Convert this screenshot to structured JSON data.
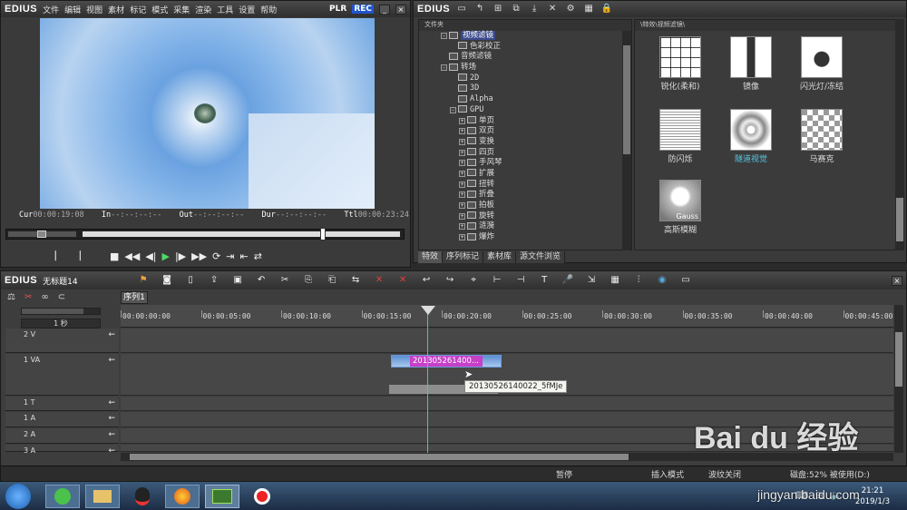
{
  "player": {
    "logo": "EDIUS",
    "menu": [
      "文件",
      "编辑",
      "视图",
      "素材",
      "标记",
      "模式",
      "采集",
      "渲染",
      "工具",
      "设置",
      "帮助"
    ],
    "plr": "PLR",
    "rec": "REC",
    "timecodes": [
      {
        "label": "Cur",
        "value": "00:00:19:08"
      },
      {
        "label": "In",
        "value": "--:--:--:--"
      },
      {
        "label": "Out",
        "value": "--:--:--:--"
      },
      {
        "label": "Dur",
        "value": "--:--:--:--"
      },
      {
        "label": "Ttl",
        "value": "00:00:23:24"
      }
    ]
  },
  "bin": {
    "logo": "EDIUS",
    "folder_header": "文件夹",
    "path_header": "\\特效\\视频滤镜\\",
    "tree": [
      {
        "indent": 2,
        "type": "folder",
        "exp": "-",
        "label": "视频滤镜",
        "selected": true
      },
      {
        "indent": 3,
        "type": "item",
        "exp": "",
        "label": "色彩校正"
      },
      {
        "indent": 2,
        "type": "item",
        "exp": "",
        "label": "音频滤镜"
      },
      {
        "indent": 2,
        "type": "folder",
        "exp": "-",
        "label": "转场"
      },
      {
        "indent": 3,
        "type": "item",
        "exp": "",
        "label": "2D"
      },
      {
        "indent": 3,
        "type": "item",
        "exp": "",
        "label": "3D"
      },
      {
        "indent": 3,
        "type": "item",
        "exp": "",
        "label": "Alpha"
      },
      {
        "indent": 3,
        "type": "folder",
        "exp": "-",
        "label": "GPU"
      },
      {
        "indent": 4,
        "type": "item",
        "exp": "+",
        "label": "单页"
      },
      {
        "indent": 4,
        "type": "item",
        "exp": "+",
        "label": "双页"
      },
      {
        "indent": 4,
        "type": "item",
        "exp": "+",
        "label": "变换"
      },
      {
        "indent": 4,
        "type": "item",
        "exp": "+",
        "label": "四页"
      },
      {
        "indent": 4,
        "type": "item",
        "exp": "+",
        "label": "手风琴"
      },
      {
        "indent": 4,
        "type": "item",
        "exp": "+",
        "label": "扩展"
      },
      {
        "indent": 4,
        "type": "item",
        "exp": "+",
        "label": "扭转"
      },
      {
        "indent": 4,
        "type": "item",
        "exp": "+",
        "label": "折叠"
      },
      {
        "indent": 4,
        "type": "item",
        "exp": "+",
        "label": "拍板"
      },
      {
        "indent": 4,
        "type": "item",
        "exp": "+",
        "label": "旋转"
      },
      {
        "indent": 4,
        "type": "item",
        "exp": "+",
        "label": "涟漪"
      },
      {
        "indent": 4,
        "type": "item",
        "exp": "+",
        "label": "爆炸"
      }
    ],
    "effects": [
      {
        "label": "锐化(柔和)",
        "kind": "grid"
      },
      {
        "label": "镜像",
        "kind": "mirror"
      },
      {
        "label": "闪光灯/冻结",
        "kind": "camera"
      },
      {
        "label": "防闪烁",
        "kind": "lines"
      },
      {
        "label": "隧道视觉",
        "kind": "tunnel",
        "highlight": true
      },
      {
        "label": "马赛克",
        "kind": "mosaic"
      },
      {
        "label": "高斯模糊",
        "kind": "gauss",
        "overlay": "Gauss"
      }
    ],
    "tabs": [
      "特效",
      "序列标记",
      "素材库",
      "源文件浏览"
    ],
    "active_tab": 0
  },
  "timeline": {
    "logo": "EDIUS",
    "project_name": "无标题14",
    "sequence_tab": "序列1",
    "zoom_label": "1 秒",
    "ruler": [
      "00:00:00:00",
      "00:00:05:00",
      "00:00:10:00",
      "00:00:15:00",
      "00:00:20:00",
      "00:00:25:00",
      "00:00:30:00",
      "00:00:35:00",
      "00:00:40:00",
      "00:00:45:00"
    ],
    "tracks": [
      {
        "name": "2 V",
        "height": 27
      },
      {
        "name": "1 VA",
        "height": 46
      },
      {
        "name": "1 T",
        "height": 16
      },
      {
        "name": "1 A",
        "height": 17
      },
      {
        "name": "2 A",
        "height": 17
      },
      {
        "name": "3 A",
        "height": 8
      }
    ],
    "clip_label": "201305261400...",
    "tooltip": "20130526140022_5fMJe",
    "status": {
      "pause": "暂停",
      "insert_mode": "插入模式",
      "ripple": "波纹关闭",
      "disk": "磁盘:52% 被使用(D:)"
    }
  },
  "taskbar": {
    "time": "21:21",
    "date": "2019/1/3"
  },
  "watermark": {
    "brand": "Bai du 经验",
    "url": "jingyan.baidu.com"
  }
}
